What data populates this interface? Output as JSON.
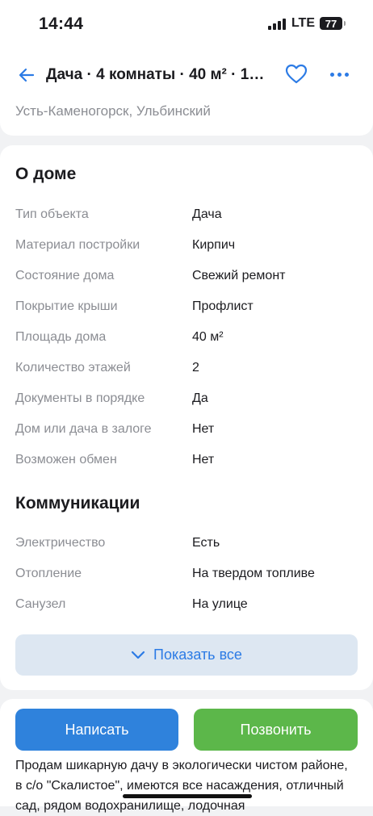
{
  "status_bar": {
    "time": "14:44",
    "network": "LTE",
    "battery": "77"
  },
  "nav": {
    "title": "Дача · 4 комнаты · 40 м² · 17..."
  },
  "address": "Усть-Каменогорск, Ульбинский",
  "about": {
    "title": "О доме",
    "rows": [
      {
        "label": "Тип объекта",
        "value": "Дача"
      },
      {
        "label": "Материал постройки",
        "value": "Кирпич"
      },
      {
        "label": "Состояние дома",
        "value": "Свежий ремонт"
      },
      {
        "label": "Покрытие крыши",
        "value": "Профлист"
      },
      {
        "label": "Площадь дома",
        "value": "40 м²"
      },
      {
        "label": "Количество этажей",
        "value": "2"
      },
      {
        "label": "Документы в порядке",
        "value": "Да"
      },
      {
        "label": "Дом или дача в залоге",
        "value": "Нет"
      },
      {
        "label": "Возможен обмен",
        "value": "Нет"
      }
    ]
  },
  "communications": {
    "title": "Коммуникации",
    "rows": [
      {
        "label": "Электричество",
        "value": "Есть"
      },
      {
        "label": "Отопление",
        "value": "На твердом топливе"
      },
      {
        "label": "Санузел",
        "value": "На улице"
      }
    ]
  },
  "show_all_label": "Показать все",
  "actions": {
    "write_label": "Написать",
    "call_label": "Позвонить"
  },
  "description": "Продам шикарную дачу в экологически чистом районе, в с/о \"Скалистое\", имеются все насаждения, отличный сад, рядом водохранилище, лодочная",
  "colors": {
    "accent": "#2c7be5",
    "write_button": "#2f82dc",
    "call_button": "#5cb74a"
  }
}
